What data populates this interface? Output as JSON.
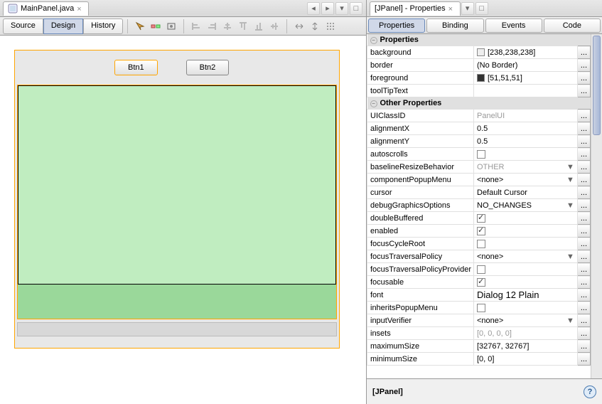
{
  "editor": {
    "tab_label": "MainPanel.java",
    "view_tabs": {
      "source": "Source",
      "design": "Design",
      "history": "History"
    },
    "canvas": {
      "btn1": "Btn1",
      "btn2": "Btn2"
    }
  },
  "props": {
    "title": "[JPanel] - Properties",
    "subtabs": {
      "properties": "Properties",
      "binding": "Binding",
      "events": "Events",
      "code": "Code"
    },
    "section_main": "Properties",
    "section_other": "Other Properties",
    "rows": {
      "background": {
        "name": "background",
        "value": "[238,238,238]",
        "swatch": "#eeeeee"
      },
      "border": {
        "name": "border",
        "value": "(No Border)"
      },
      "foreground": {
        "name": "foreground",
        "value": "[51,51,51]",
        "swatch": "#333333"
      },
      "toolTipText": {
        "name": "toolTipText",
        "value": ""
      },
      "UIClassID": {
        "name": "UIClassID",
        "value": "PanelUI"
      },
      "alignmentX": {
        "name": "alignmentX",
        "value": "0.5"
      },
      "alignmentY": {
        "name": "alignmentY",
        "value": "0.5"
      },
      "autoscrolls": {
        "name": "autoscrolls",
        "checked": false
      },
      "baselineResizeBehavior": {
        "name": "baselineResizeBehavior",
        "value": "OTHER"
      },
      "componentPopupMenu": {
        "name": "componentPopupMenu",
        "value": "<none>"
      },
      "cursor": {
        "name": "cursor",
        "value": "Default Cursor"
      },
      "debugGraphicsOptions": {
        "name": "debugGraphicsOptions",
        "value": "NO_CHANGES"
      },
      "doubleBuffered": {
        "name": "doubleBuffered",
        "checked": true
      },
      "enabled": {
        "name": "enabled",
        "checked": true
      },
      "focusCycleRoot": {
        "name": "focusCycleRoot",
        "checked": false
      },
      "focusTraversalPolicy": {
        "name": "focusTraversalPolicy",
        "value": "<none>"
      },
      "focusTraversalPolicyProvider": {
        "name": "focusTraversalPolicyProvider",
        "checked": false
      },
      "focusable": {
        "name": "focusable",
        "checked": true
      },
      "font": {
        "name": "font",
        "value": "Dialog 12 Plain"
      },
      "inheritsPopupMenu": {
        "name": "inheritsPopupMenu",
        "checked": false
      },
      "inputVerifier": {
        "name": "inputVerifier",
        "value": "<none>"
      },
      "insets": {
        "name": "insets",
        "value": "[0, 0, 0, 0]"
      },
      "maximumSize": {
        "name": "maximumSize",
        "value": "[32767, 32767]"
      },
      "minimumSize": {
        "name": "minimumSize",
        "value": "[0, 0]"
      }
    },
    "footer": "[JPanel]",
    "ellipsis": "..."
  }
}
